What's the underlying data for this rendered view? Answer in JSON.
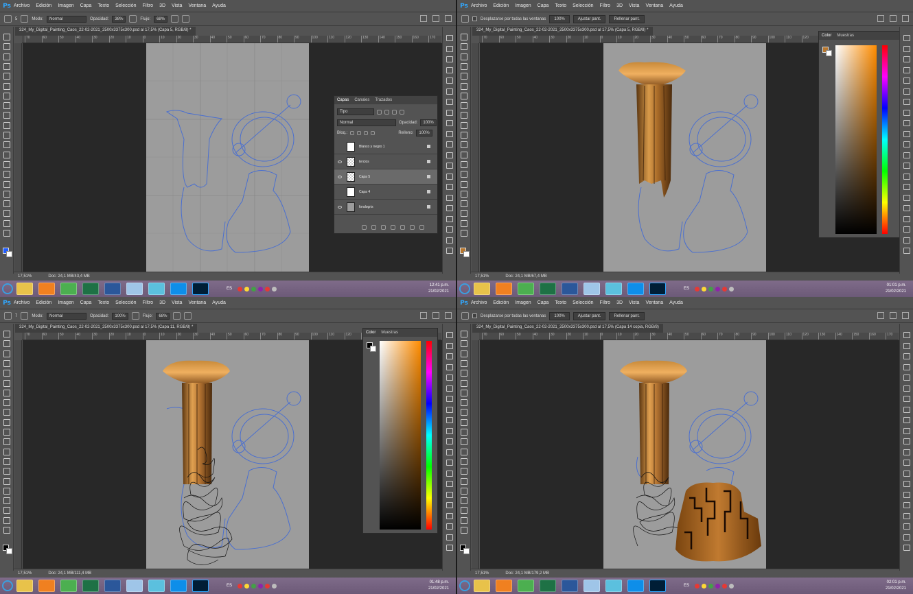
{
  "quadrants": [
    {
      "app": "Ps",
      "menu": [
        "Archivo",
        "Edición",
        "Imagen",
        "Capa",
        "Texto",
        "Selección",
        "Filtro",
        "3D",
        "Vista",
        "Ventana",
        "Ayuda"
      ],
      "options": {
        "mode_label": "Modo:",
        "mode_value": "Normal",
        "opacity_label": "Opacidad:",
        "opacity_value": "38%",
        "flow_label": "Flujo:",
        "flow_value": "68%",
        "brush_size": "5"
      },
      "doc_tab": "324_My_Digital_Painting_Caos_22-02-2021_2500x3375x300.psd al 17,5% (Capa 5, RGB/8) *",
      "zoom": "17,51%",
      "doc_size": "Doc: 24,1 MB/43,4 MB",
      "ruler": [
        "70",
        "60",
        "50",
        "40",
        "30",
        "20",
        "10",
        "0",
        "10",
        "20",
        "30",
        "40",
        "50",
        "60",
        "70",
        "80",
        "90",
        "100",
        "110",
        "120",
        "130",
        "140",
        "150",
        "160",
        "170"
      ],
      "time": "12:41 p.m.",
      "date": "21/02/2021",
      "lang": "ES"
    },
    {
      "app": "Ps",
      "menu": [
        "Archivo",
        "Edición",
        "Imagen",
        "Capa",
        "Texto",
        "Selección",
        "Filtro",
        "3D",
        "Vista",
        "Ventana",
        "Ayuda"
      ],
      "options": {
        "scroll_all": "Desplazarse por todas las ventanas",
        "zoom_btn": "100%",
        "fit_btn": "Ajustar pant.",
        "fill_btn": "Rellenar pant."
      },
      "doc_tab": "324_My_Digital_Painting_Caos_22-02-2021_2500x3375x300.psd al 17,5% (Capa 5, RGB/8) *",
      "zoom": "17,51%",
      "doc_size": "Doc: 24,1 MB/67,4 MB",
      "ruler": [
        "70",
        "60",
        "50",
        "40",
        "30",
        "20",
        "10",
        "0",
        "10",
        "20",
        "30",
        "40",
        "50",
        "60",
        "70",
        "80",
        "90",
        "100",
        "110",
        "120",
        "130",
        "140",
        "150",
        "160",
        "170"
      ],
      "time": "01:01 p.m.",
      "date": "21/02/2021",
      "lang": "ES"
    },
    {
      "app": "Ps",
      "menu": [
        "Archivo",
        "Edición",
        "Imagen",
        "Capa",
        "Texto",
        "Selección",
        "Filtro",
        "3D",
        "Vista",
        "Ventana",
        "Ayuda"
      ],
      "options": {
        "mode_label": "Modo:",
        "mode_value": "Normal",
        "opacity_label": "Opacidad:",
        "opacity_value": "100%",
        "flow_label": "Flujo:",
        "flow_value": "68%",
        "brush_size": "7"
      },
      "doc_tab": "324_My_Digital_Painting_Caos_22-02-2021_2500x3375x300.psd al 17,5% (Capa 11, RGB/8) *",
      "zoom": "17,51%",
      "doc_size": "Doc: 24,1 MB/111,4 MB",
      "ruler": [
        "70",
        "60",
        "50",
        "40",
        "30",
        "20",
        "10",
        "0",
        "10",
        "20",
        "30",
        "40",
        "50",
        "60",
        "70",
        "80",
        "90",
        "100",
        "110",
        "120",
        "130",
        "140",
        "150",
        "160",
        "170"
      ],
      "time": "01:48 p.m.",
      "date": "21/02/2021",
      "lang": "ES"
    },
    {
      "app": "Ps",
      "menu": [
        "Archivo",
        "Edición",
        "Imagen",
        "Capa",
        "Texto",
        "Selección",
        "Filtro",
        "3D",
        "Vista",
        "Ventana",
        "Ayuda"
      ],
      "options": {
        "scroll_all": "Desplazarse por todas las ventanas",
        "zoom_btn": "100%",
        "fit_btn": "Ajustar pant.",
        "fill_btn": "Rellenar pant."
      },
      "doc_tab": "324_My_Digital_Painting_Caos_22-02-2021_2500x3375x300.psd al 17,5% (Capa 14 copia, RGB/8)",
      "zoom": "17,51%",
      "doc_size": "Doc: 24,1 MB/179,2 MB",
      "ruler": [
        "70",
        "60",
        "50",
        "40",
        "30",
        "20",
        "10",
        "0",
        "10",
        "20",
        "30",
        "40",
        "50",
        "60",
        "70",
        "80",
        "90",
        "100",
        "110",
        "120",
        "130",
        "140",
        "150",
        "160",
        "170"
      ],
      "time": "02:01 p.m.",
      "date": "21/02/2021",
      "lang": "ES"
    }
  ],
  "layers_panel": {
    "tabs": [
      "Capas",
      "Canales",
      "Trazados"
    ],
    "filter": "Tipo",
    "blend": "Normal",
    "opacity_label": "Opacidad:",
    "opacity": "100%",
    "lock_label": "Bloq.:",
    "fill_label": "Relleno:",
    "fill": "100%",
    "layers": [
      {
        "name": "Blanco y negro 1",
        "visible": false,
        "selected": false
      },
      {
        "name": "tercios",
        "visible": true,
        "selected": false
      },
      {
        "name": "Capa 5",
        "visible": true,
        "selected": true
      },
      {
        "name": "Capa 4",
        "visible": false,
        "selected": false
      },
      {
        "name": "fondogris",
        "visible": true,
        "selected": false
      }
    ]
  },
  "color_panel": {
    "tabs": [
      "Color",
      "Muestras"
    ]
  },
  "colors": {
    "ps_bg": "#535353",
    "canvas": "#9c9c9c",
    "sketch": "#4a6fd0",
    "wood": "#b8782f",
    "taskbar": "#7b688a",
    "ps_blue": "#31a8ff"
  },
  "taskbar_apps": [
    "explorer-icon",
    "media-icon",
    "chrome-icon",
    "excel-icon",
    "word-icon",
    "notepad-icon",
    "pen-icon",
    "teamviewer-icon",
    "photoshop-icon"
  ]
}
